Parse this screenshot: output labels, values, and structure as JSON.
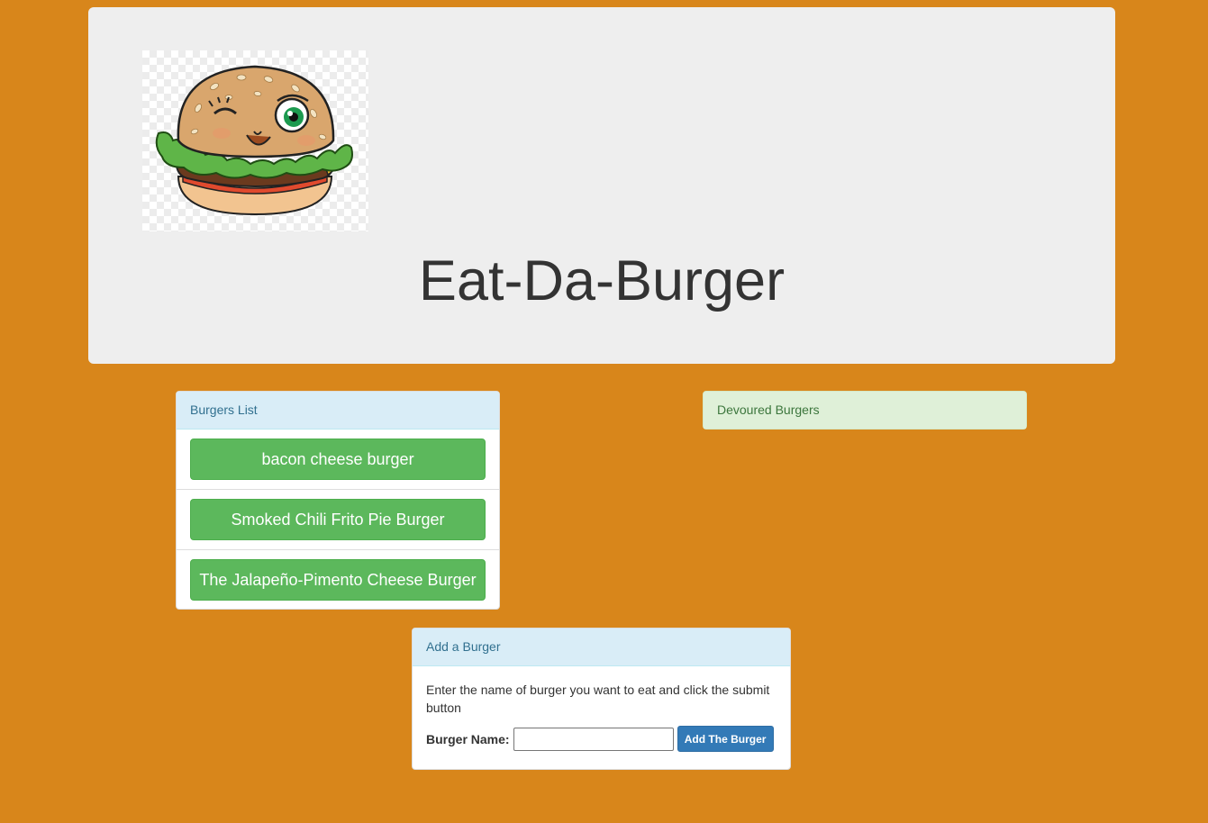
{
  "header": {
    "title": "Eat-Da-Burger",
    "logo_icon": "winking-burger-icon"
  },
  "burgers_panel": {
    "heading": "Burgers List",
    "items": [
      {
        "label": "bacon cheese burger"
      },
      {
        "label": "Smoked Chili Frito Pie Burger"
      },
      {
        "label": "The Jalapeño-Pimento Cheese Burger"
      }
    ]
  },
  "devoured_panel": {
    "heading": "Devoured Burgers"
  },
  "add_panel": {
    "heading": "Add a Burger",
    "instructions": "Enter the name of burger you want to eat and click the submit button",
    "field_label": "Burger Name:",
    "field_value": "",
    "submit_label": "Add The Burger"
  },
  "colors": {
    "page_background": "#d8861b",
    "jumbotron": "#eeeeee",
    "success_button": "#5cb85c",
    "primary_button": "#337ab7"
  }
}
